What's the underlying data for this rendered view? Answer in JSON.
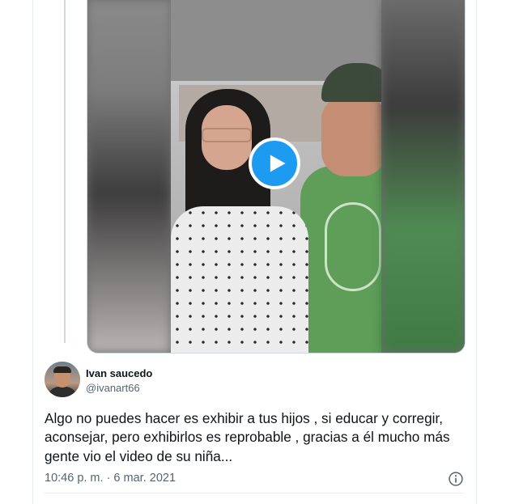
{
  "tweet": {
    "author": {
      "display_name": "Ivan saucedo",
      "handle": "@ivanart66"
    },
    "text": "Algo no puedes hacer es exhibir a tus hijos , si educar y corregir, aconsejar, pero exhibirlos es reprobable , gracias a él mucho más gente vio el video de su niña...",
    "timestamp": "10:46 p. m. · 6 mar. 2021"
  },
  "colors": {
    "accent": "#1d9bf0",
    "text_primary": "#0f1419",
    "text_secondary": "#536471",
    "border": "#e6ecf0"
  },
  "icons": {
    "play": "play-icon",
    "info": "info-icon"
  }
}
